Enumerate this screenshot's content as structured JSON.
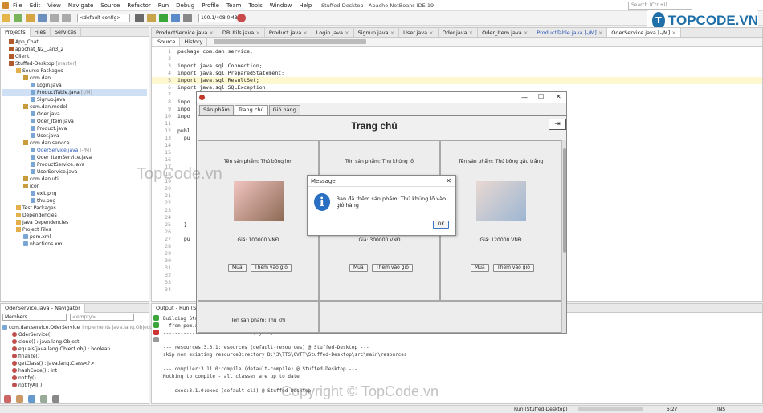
{
  "window": {
    "title": "Stuffed-Desktop - Apache NetBeans IDE 19",
    "search_placeholder": "Search (Ctrl+I)"
  },
  "menu": [
    "File",
    "Edit",
    "View",
    "Navigate",
    "Source",
    "Refactor",
    "Run",
    "Debug",
    "Profile",
    "Team",
    "Tools",
    "Window",
    "Help"
  ],
  "toolbar": {
    "config": "<default config>",
    "memory": "190.1/408.0MB"
  },
  "logo": {
    "mark": "T",
    "text": "TOPCODE.VN"
  },
  "projects_panel": {
    "tabs": [
      "Projects",
      "Files",
      "Services"
    ],
    "tree": [
      {
        "t": "App_Chat",
        "d": 0,
        "k": "prj"
      },
      {
        "t": "appchat_N2_Lan3_2",
        "d": 0,
        "k": "prj"
      },
      {
        "t": "Client",
        "d": 0,
        "k": "prj"
      },
      {
        "t": "Stuffed-Desktop",
        "note": "[master]",
        "d": 0,
        "k": "prj"
      },
      {
        "t": "Source Packages",
        "d": 1,
        "k": "fol"
      },
      {
        "t": "com.dan",
        "d": 2,
        "k": "pkg"
      },
      {
        "t": "Login.java",
        "d": 3,
        "k": "jf"
      },
      {
        "t": "ProductTable.java",
        "note": "[-/M]",
        "d": 3,
        "k": "jf",
        "sel": true
      },
      {
        "t": "Signup.java",
        "d": 3,
        "k": "jf"
      },
      {
        "t": "com.dan.model",
        "d": 2,
        "k": "pkg"
      },
      {
        "t": "Oder.java",
        "d": 3,
        "k": "jf"
      },
      {
        "t": "Oder_Item.java",
        "d": 3,
        "k": "jf"
      },
      {
        "t": "Product.java",
        "d": 3,
        "k": "jf"
      },
      {
        "t": "User.java",
        "d": 3,
        "k": "jf"
      },
      {
        "t": "com.dan.service",
        "d": 2,
        "k": "pkg"
      },
      {
        "t": "OderService.java",
        "note": "[-/M]",
        "d": 3,
        "k": "jf",
        "blue": true
      },
      {
        "t": "Oder_ItemService.java",
        "d": 3,
        "k": "jf"
      },
      {
        "t": "ProductService.java",
        "d": 3,
        "k": "jf"
      },
      {
        "t": "UserService.java",
        "d": 3,
        "k": "jf"
      },
      {
        "t": "com.dan.util",
        "d": 2,
        "k": "pkg"
      },
      {
        "t": "icon",
        "d": 2,
        "k": "pkg"
      },
      {
        "t": "exit.png",
        "d": 3,
        "k": "jf"
      },
      {
        "t": "thu.png",
        "d": 3,
        "k": "jf"
      },
      {
        "t": "Test Packages",
        "d": 1,
        "k": "fol"
      },
      {
        "t": "Dependencies",
        "d": 1,
        "k": "fol"
      },
      {
        "t": "Java Dependencies",
        "d": 1,
        "k": "fol"
      },
      {
        "t": "Project Files",
        "d": 1,
        "k": "fol"
      },
      {
        "t": "pom.xml",
        "d": 2,
        "k": "jf"
      },
      {
        "t": "nbactions.xml",
        "d": 2,
        "k": "jf"
      }
    ]
  },
  "navigator": {
    "title": "OderService.java - Navigator",
    "filter": "Members",
    "empty": "<empty>",
    "root": "com.dan.service.OderService",
    "root_note": "implements java.lang.Object",
    "items": [
      "OderService()",
      "clone() : java.lang.Object",
      "equals(java.lang.Object obj) : boolean",
      "finalize()",
      "getClass() : java.lang.Class<?>",
      "hashCode() : int",
      "notify()",
      "notifyAll()"
    ]
  },
  "editor": {
    "tabs": [
      "ProductService.java",
      "DBUtils.java",
      "Product.java",
      "Login.java",
      "Signup.java",
      "User.java",
      "Oder.java",
      "Oder_Item.java",
      "ProductTable.java [-/M]",
      "OderService.java [-/M]"
    ],
    "subtabs": [
      "Source",
      "History"
    ],
    "lines": [
      {
        "n": "1",
        "c": "package com.dan.service;"
      },
      {
        "n": "2",
        "c": ""
      },
      {
        "n": "3",
        "c": "import java.sql.Connection;"
      },
      {
        "n": "4",
        "c": "import java.sql.PreparedStatement;"
      },
      {
        "n": "5",
        "c": "import java.sql.ResultSet;"
      },
      {
        "n": "6",
        "c": "import java.sql.SQLException;"
      },
      {
        "n": "7",
        "c": ""
      },
      {
        "n": "8",
        "c": "impo"
      },
      {
        "n": "9",
        "c": "impo"
      },
      {
        "n": "10",
        "c": "impo"
      },
      {
        "n": "11",
        "c": ""
      },
      {
        "n": "12",
        "c": "publ"
      },
      {
        "n": "13",
        "c": "  pu"
      },
      {
        "n": "14",
        "c": ""
      },
      {
        "n": "15",
        "c": ""
      },
      {
        "n": "16",
        "c": ""
      },
      {
        "n": "17",
        "c": ""
      },
      {
        "n": "18",
        "c": ""
      },
      {
        "n": "19",
        "c": ""
      },
      {
        "n": "20",
        "c": ""
      },
      {
        "n": "21",
        "c": ""
      },
      {
        "n": "22",
        "c": ""
      },
      {
        "n": "23",
        "c": ""
      },
      {
        "n": "24",
        "c": ""
      },
      {
        "n": "25",
        "c": "  }"
      },
      {
        "n": "26",
        "c": ""
      },
      {
        "n": "27",
        "c": "  pu"
      },
      {
        "n": "28",
        "c": ""
      },
      {
        "n": "29",
        "c": ""
      },
      {
        "n": "30",
        "c": ""
      },
      {
        "n": "31",
        "c": ""
      },
      {
        "n": "32",
        "c": ""
      },
      {
        "n": "33",
        "c": ""
      },
      {
        "n": "34",
        "c": ""
      }
    ]
  },
  "output": {
    "title": "Output - Run (Stuffed-Desktop)",
    "lines": [
      "Building Stuffed-Desktop 1.0-SNAPSHOT",
      "  from pom.xml",
      "-------------------------------[ jar ]-------------------------------",
      "",
      "--- resources:3.3.1:resources (default-resources) @ Stuffed-Desktop ---",
      "skip non existing resourceDirectory D:\\3\\TTS\\CVTT\\Stuffed-Desktop\\src\\main\\resources",
      "",
      "--- compiler:3.11.0:compile (default-compile) @ Stuffed-Desktop ---",
      "Nothing to compile - all classes are up to date",
      "",
      "--- exec:3.1.0:exec (default-cli) @ Stuffed-Desktop ---"
    ]
  },
  "app": {
    "tabs": [
      "Sản phẩm",
      "Trang chủ",
      "Giỏ hàng"
    ],
    "active_tab": 1,
    "heading": "Trang chủ",
    "products": [
      {
        "name": "Tên sản phẩm: Thú bông lợn",
        "price": "Giá: 100000 VNĐ",
        "colors": [
          "#f2c5c0",
          "#8d6a55"
        ]
      },
      {
        "name": "Tên sản phẩm: Thú khủng lồ",
        "price": "Giá: 300000 VNĐ",
        "colors": [
          "#ececec",
          "#ececec"
        ]
      },
      {
        "name": "Tên sản phẩm: Thú bông gấu trắng",
        "price": "Giá: 120000 VNĐ",
        "colors": [
          "#e8d8d2",
          "#9db6d2"
        ]
      }
    ],
    "partial_name": "Tên sản phẩm: Thú khỉ",
    "buy_label": "Mua",
    "add_label": "Thêm vào giỏ"
  },
  "dialog": {
    "title": "Message",
    "text": "Bạn đã thêm sản phẩm: Thú khủng lồ vào giỏ hàng",
    "ok": "OK"
  },
  "status": {
    "run": "Run (Stuffed-Desktop)",
    "pos": "5:27",
    "mode": "INS"
  },
  "watermark": {
    "center": "TopCode.vn",
    "bottom": "Copyright © TopCode.vn"
  }
}
